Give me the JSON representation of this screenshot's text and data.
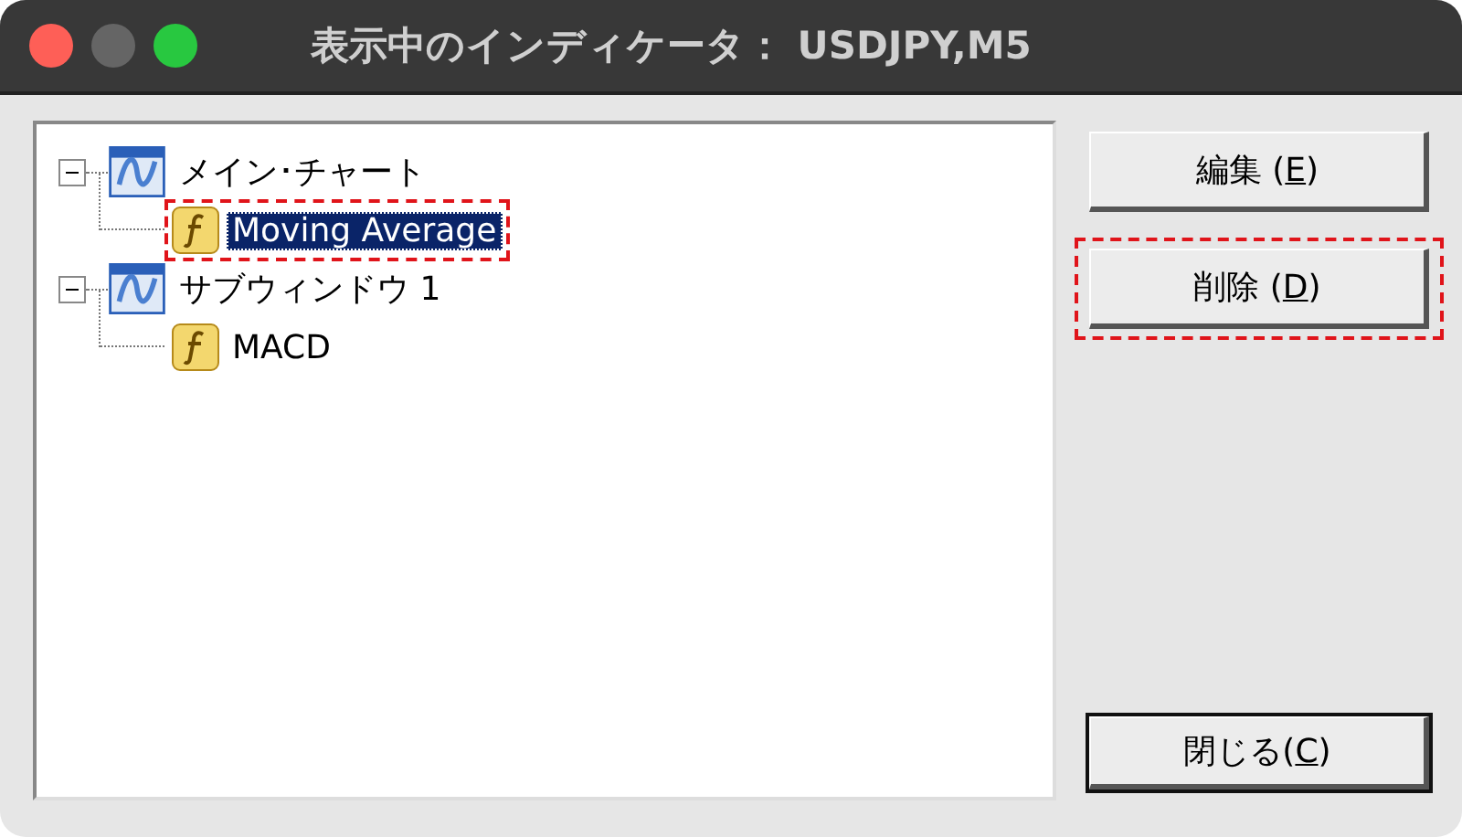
{
  "window": {
    "title": "表示中のインディケータ： USDJPY,M5"
  },
  "tree": [
    {
      "label": "メイン･チャート",
      "kind": "window",
      "expanded": true,
      "selected": false,
      "children": [
        {
          "label": "Moving Average",
          "kind": "function",
          "selected": true,
          "highlighted": true
        }
      ]
    },
    {
      "label": "サブウィンドウ 1",
      "kind": "window",
      "expanded": true,
      "selected": false,
      "children": [
        {
          "label": "MACD",
          "kind": "function",
          "selected": false,
          "highlighted": false
        }
      ]
    }
  ],
  "buttons": [
    {
      "before": "編集 (",
      "key": "E",
      "after": ")",
      "highlighted": false,
      "default": false
    },
    {
      "before": "削除 (",
      "key": "D",
      "after": ")",
      "highlighted": true,
      "default": false
    },
    {
      "before": "閉じる(",
      "key": "C",
      "after": ")",
      "highlighted": false,
      "default": true
    }
  ]
}
